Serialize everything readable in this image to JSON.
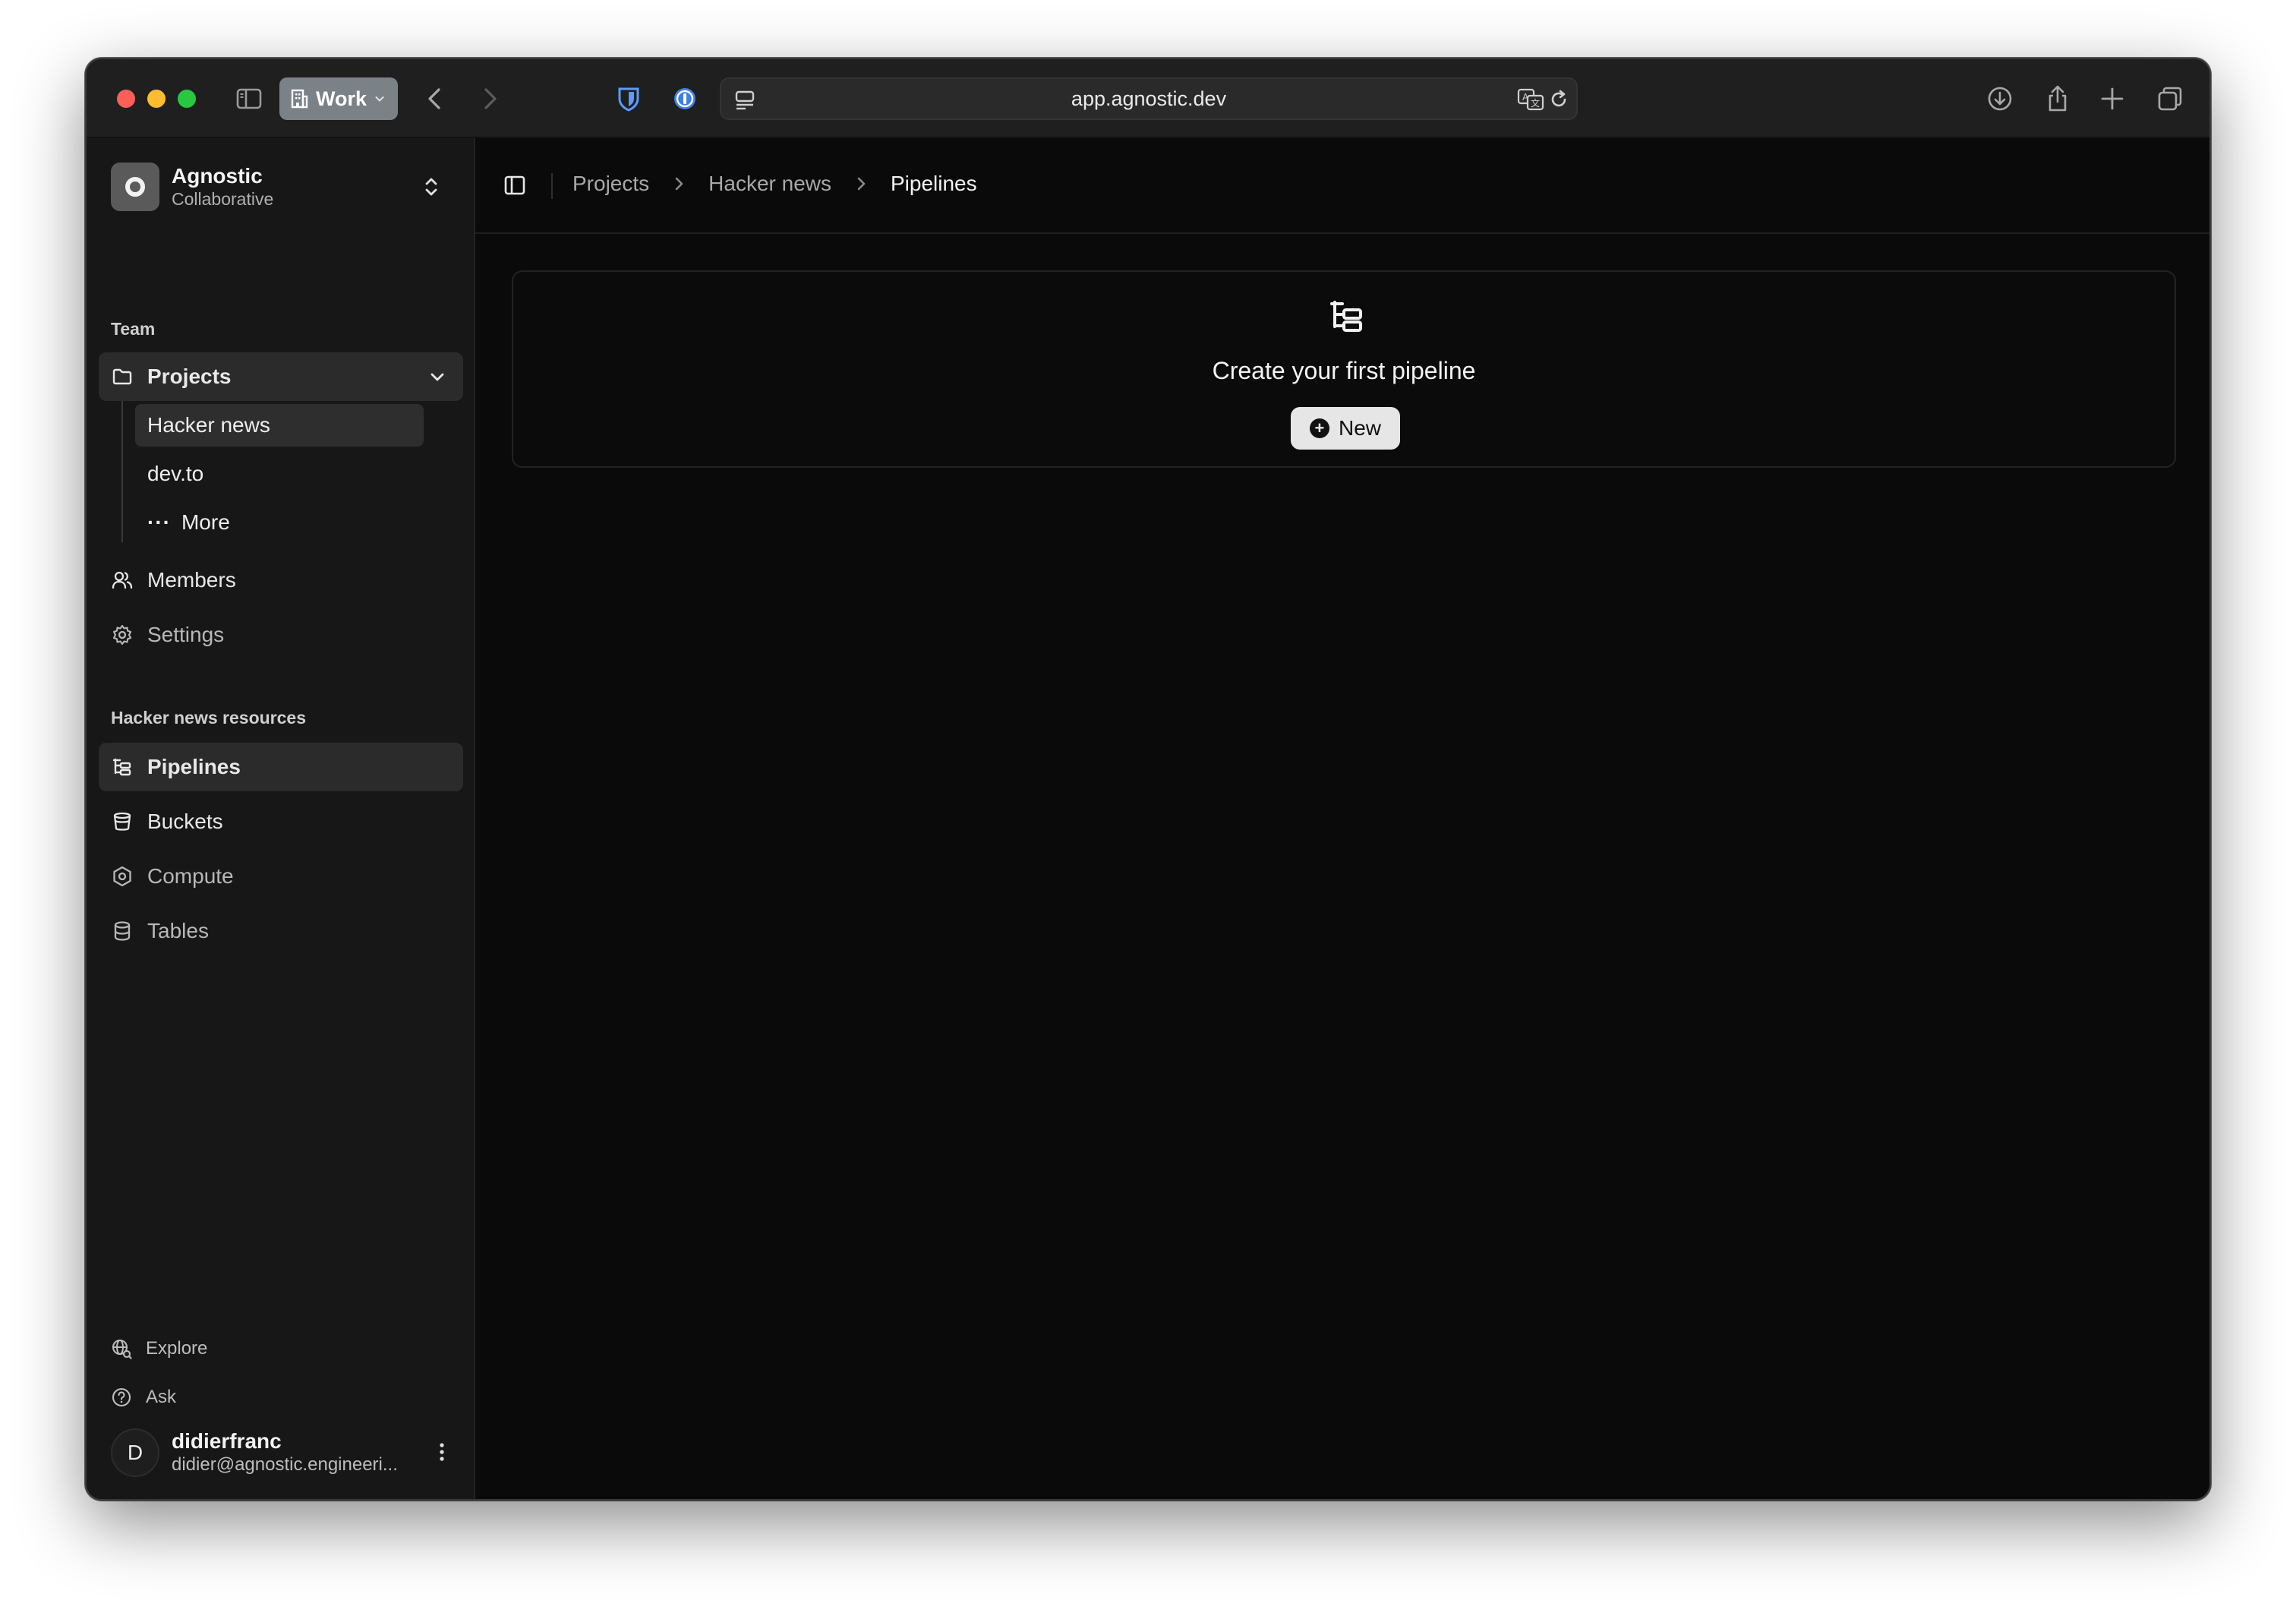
{
  "browser": {
    "profile_label": "Work",
    "url": "app.agnostic.dev",
    "icons": [
      "sidebar-icon",
      "building-icon",
      "back-icon",
      "forward-icon",
      "bitwarden-icon",
      "onepassword-icon",
      "page-menu-icon",
      "translate-icon",
      "reload-icon",
      "download-icon",
      "share-icon",
      "new-tab-icon",
      "tabs-overview-icon"
    ]
  },
  "sidebar": {
    "org": {
      "name": "Agnostic",
      "subtitle": "Collaborative"
    },
    "team_label": "Team",
    "projects_label": "Projects",
    "projects": [
      {
        "label": "Hacker news",
        "active": true
      },
      {
        "label": "dev.to",
        "active": false
      }
    ],
    "more_label": "More",
    "members_label": "Members",
    "settings_label": "Settings",
    "resources_label": "Hacker news resources",
    "resources": [
      {
        "label": "Pipelines",
        "active": true
      },
      {
        "label": "Buckets",
        "active": false
      },
      {
        "label": "Compute",
        "active": false
      },
      {
        "label": "Tables",
        "active": false
      }
    ],
    "footer": {
      "explore_label": "Explore",
      "ask_label": "Ask"
    },
    "user": {
      "initial": "D",
      "name": "didierfranc",
      "email": "didier@agnostic.engineeri..."
    }
  },
  "main": {
    "breadcrumb": [
      "Projects",
      "Hacker news",
      "Pipelines"
    ],
    "empty_state": {
      "title": "Create your first pipeline",
      "button_label": "New"
    }
  }
}
